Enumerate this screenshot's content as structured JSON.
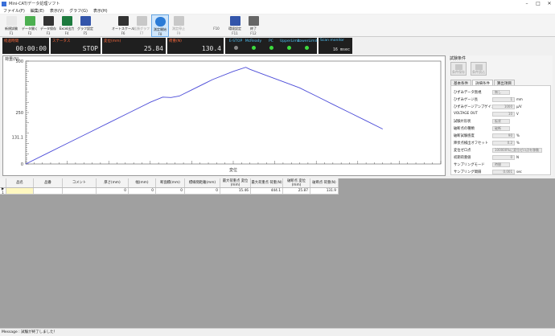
{
  "window": {
    "title": "Mini-CAT/データ処理ソフト",
    "controls": [
      "–",
      "□",
      "✕"
    ]
  },
  "menu": [
    "ファイル(F)",
    "編集(E)",
    "表示(V)",
    "グラフ(G)",
    "表示(H)"
  ],
  "toolbar": [
    {
      "label": "新規試験",
      "key": "F1",
      "icon": "new-file-icon",
      "color": "#e8e8e8"
    },
    {
      "label": "データ開く",
      "key": "F2",
      "icon": "open-folder-icon",
      "color": "#4caf50"
    },
    {
      "label": "データ保存",
      "key": "F3",
      "icon": "save-disk-icon",
      "color": "#333333"
    },
    {
      "label": "Excel出力",
      "key": "F4",
      "icon": "excel-icon",
      "color": "#1d7a3e"
    },
    {
      "label": "グラフ設定",
      "key": "F5",
      "icon": "graph-settings-icon",
      "color": "#3355aa"
    },
    {
      "label": "オートスケール",
      "key": "F6",
      "icon": "autoscale-icon",
      "color": "#333333"
    },
    {
      "label": "拡張グラフ",
      "key": "F7",
      "icon": "extended-graph-icon",
      "color": "#c8c8c8"
    },
    {
      "label": "測定開始",
      "key": "F8",
      "icon": "start-measure-icon",
      "color": "#2b7bd6"
    },
    {
      "label": "測定停止",
      "key": "F9",
      "icon": "stop-measure-icon",
      "color": "#c8c8c8"
    },
    {
      "label": "",
      "key": "F10",
      "icon": "blank-icon",
      "color": "#f4f4f4"
    },
    {
      "label": "環境設定",
      "key": "F11",
      "icon": "env-settings-icon",
      "color": "#3355aa"
    },
    {
      "label": "終了",
      "key": "F12",
      "icon": "exit-icon",
      "color": "#666666"
    }
  ],
  "status": {
    "elapsed": {
      "label": "経過時間",
      "value": "00:00:00"
    },
    "state": {
      "label": "ステータス",
      "value": "STOP"
    },
    "displacement": {
      "label": "変位(mm)",
      "value": "25.84"
    },
    "load": {
      "label": "荷重(N)",
      "value": "130.4"
    },
    "lamps": [
      {
        "label": "E-STOP",
        "color": "#888888"
      },
      {
        "label": "McReady",
        "color": "#3ddc3d"
      },
      {
        "label": "PC",
        "color": "#3ddc3d"
      },
      {
        "label": "UpperLimit",
        "color": "#3ddc3d"
      },
      {
        "label": "LowerLimit",
        "color": "#3ddc3d"
      }
    ],
    "scan": {
      "label": "Scan monitor",
      "value": "16 msec"
    }
  },
  "chart_data": {
    "type": "line",
    "ylabel": "荷重(N)",
    "xlabel": "変位",
    "y_ticks": [
      "500",
      "250",
      "131.1",
      "0"
    ],
    "xlim": [
      0,
      50
    ],
    "ylim": [
      0,
      500
    ],
    "x": [
      0,
      2.5,
      5,
      7.5,
      10,
      12.5,
      15,
      16.5,
      17.5,
      18.5,
      20,
      22.5,
      25,
      26.5,
      27,
      29,
      31,
      33,
      35,
      37,
      39,
      41,
      43
    ],
    "values": [
      0,
      50,
      100,
      150,
      200,
      250,
      300,
      325,
      323,
      330,
      360,
      410,
      450,
      470,
      460,
      430,
      400,
      370,
      330,
      290,
      250,
      210,
      170
    ],
    "color": "#4b4bd8"
  },
  "conditions": {
    "title": "試験条件",
    "buttons": [
      "条件保存",
      "条件読込"
    ],
    "tabs": [
      "基本条件",
      "詳細条件",
      "算出項目"
    ],
    "rows": [
      {
        "label": "ひずみデータ無視",
        "value": "無し",
        "unit": ""
      },
      {
        "label": "ひずみゲージ長",
        "value": "1",
        "unit": "mm"
      },
      {
        "label": "ひずみゲージアンプゲイン",
        "value": "1000",
        "unit": "μ/V"
      },
      {
        "label": "VOLTAGE OUT",
        "value": "10",
        "unit": "V"
      },
      {
        "label": "試験片形状",
        "value": "板状",
        "unit": ""
      },
      {
        "label": "破断点の種類",
        "value": "破断",
        "unit": ""
      },
      {
        "label": "破断試験感度",
        "value": "90",
        "unit": "%"
      },
      {
        "label": "降伏点検出オフセット",
        "value": "0.2",
        "unit": "%"
      },
      {
        "label": "変位ゼロ点",
        "value": "100000%に変位ゼロ点を移動",
        "unit": ""
      },
      {
        "label": "初期荷重値",
        "value": "0",
        "unit": "N"
      },
      {
        "label": "サンプリングモード",
        "value": "時間",
        "unit": ""
      },
      {
        "label": "サンプリング間隔",
        "value": "0.001",
        "unit": "sec"
      }
    ]
  },
  "results": {
    "headers": [
      "",
      "品名",
      "品番",
      "コメント",
      "厚さ(mm)",
      "幅(mm)",
      "断面積(mm)",
      "標線間距離(mm)",
      "最大荷重点 変位(mm)",
      "最大荷重点 荷重(N)",
      "破断点 変位(mm)",
      "破断点 荷重(N)"
    ],
    "rows": [
      [
        "▶ 1",
        "",
        "",
        "",
        "0",
        "0",
        "0",
        "0",
        "15.46",
        "444.1",
        "25.87",
        "131.9"
      ]
    ]
  },
  "statusbar": {
    "message": "Message : 試験が終了しました！"
  }
}
